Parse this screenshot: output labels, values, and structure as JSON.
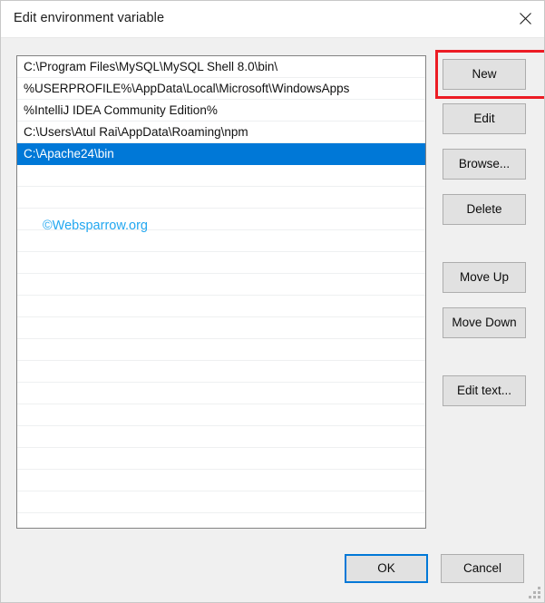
{
  "window": {
    "title": "Edit environment variable",
    "close_icon": "close-icon"
  },
  "list": {
    "entries": [
      "C:\\Program Files\\MySQL\\MySQL Shell 8.0\\bin\\",
      "%USERPROFILE%\\AppData\\Local\\Microsoft\\WindowsApps",
      "%IntelliJ IDEA Community Edition%",
      "C:\\Users\\Atul Rai\\AppData\\Roaming\\npm",
      "C:\\Apache24\\bin"
    ],
    "selected_index": 4,
    "empty_row_count": 16,
    "selection_color": "#0078d7"
  },
  "watermark": {
    "text": "©Websparrow.org",
    "color": "#22a7f0"
  },
  "side_buttons": {
    "new": "New",
    "edit": "Edit",
    "browse": "Browse...",
    "delete": "Delete",
    "move_up": "Move Up",
    "move_down": "Move Down",
    "edit_text": "Edit text..."
  },
  "annotation": {
    "target": "New",
    "color": "#ec1c24"
  },
  "footer": {
    "ok": "OK",
    "cancel": "Cancel"
  }
}
